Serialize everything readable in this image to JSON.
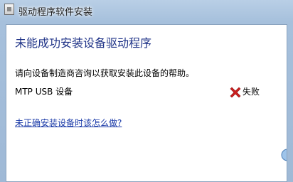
{
  "window": {
    "title": "驱动程序软件安装"
  },
  "main": {
    "heading": "未能成功安装设备驱动程序",
    "description": "请向设备制造商咨询以获取安装此设备的帮助。",
    "devices": [
      {
        "name": "MTP USB 设备",
        "status": "失败",
        "status_icon": "red-x-icon"
      }
    ],
    "help_link": "未正确安装设备时该怎么做?"
  },
  "colors": {
    "heading": "#1e3287",
    "link": "#1a3aa8",
    "error": "#cc1f1f"
  }
}
